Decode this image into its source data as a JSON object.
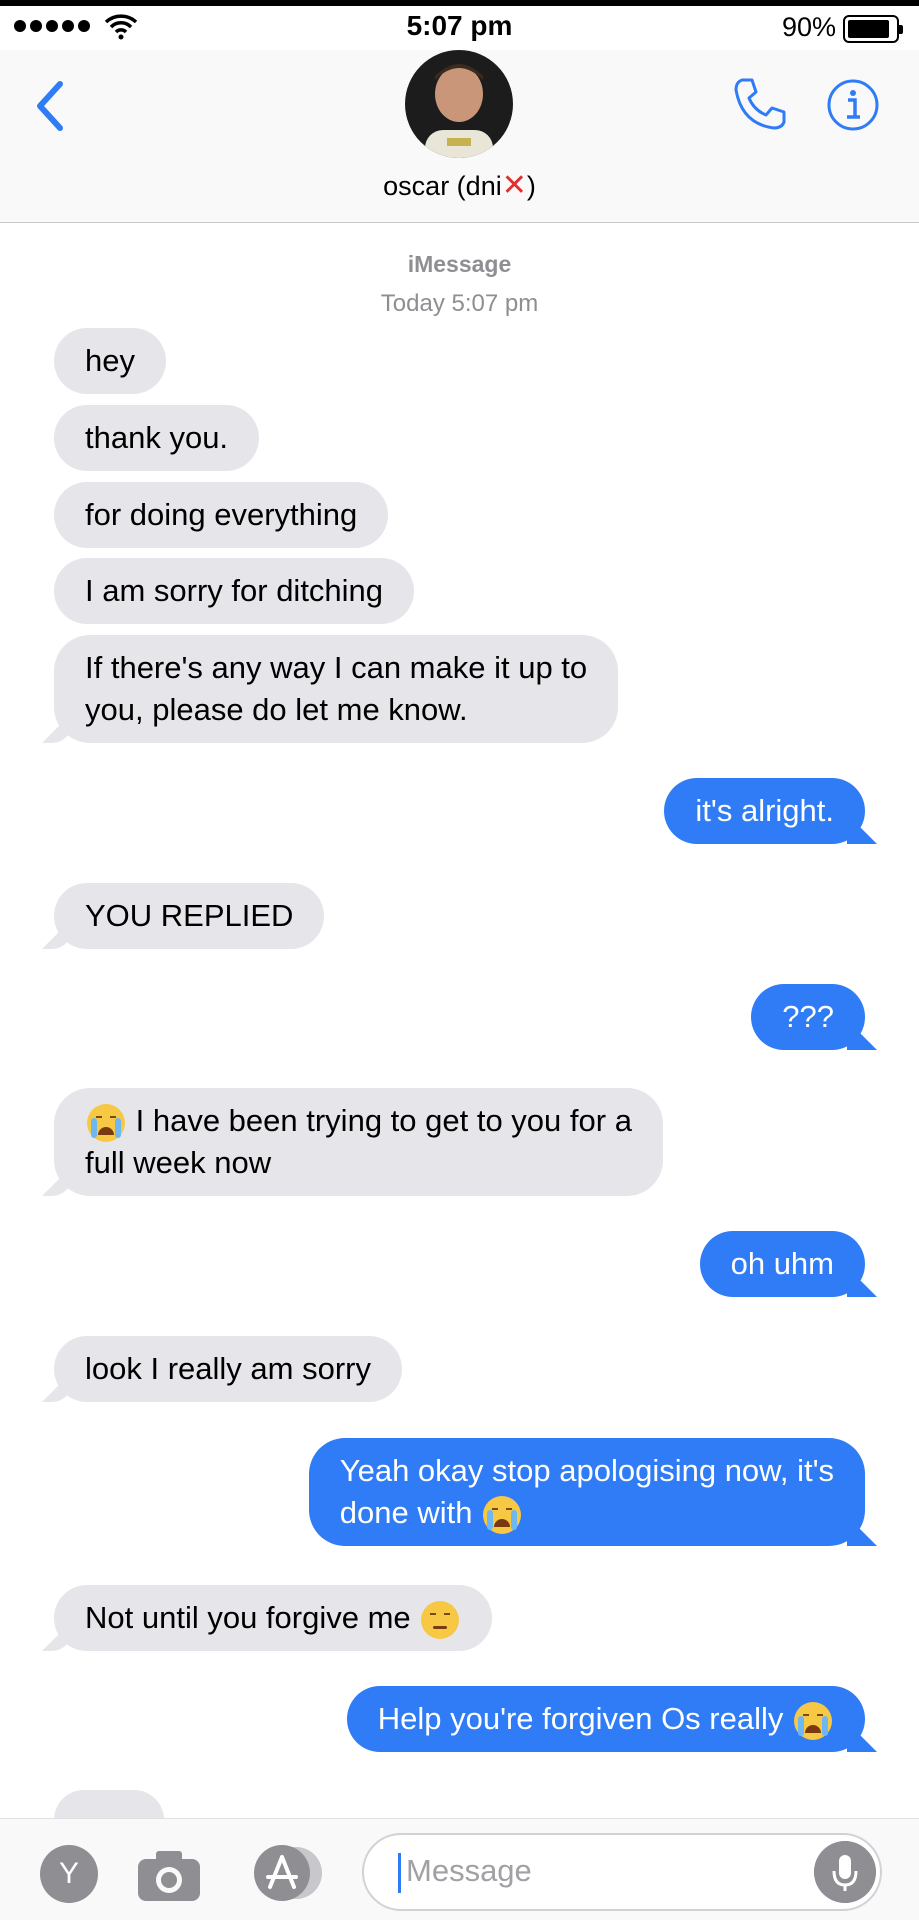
{
  "status": {
    "time": "5:07 pm",
    "battery": "90%"
  },
  "header": {
    "contact_name": "oscar (dni",
    "contact_suffix": ")"
  },
  "thread": {
    "service": "iMessage",
    "timestamp": "Today 5:07 pm"
  },
  "messages": [
    {
      "side": "in",
      "text": "hey"
    },
    {
      "side": "in",
      "text": "thank you."
    },
    {
      "side": "in",
      "text": "for doing everything"
    },
    {
      "side": "in",
      "text": "I am sorry for ditching"
    },
    {
      "side": "in",
      "line1": "If there's any way I can make it up to",
      "line2": "you, please do let me know."
    },
    {
      "side": "out",
      "text": "it's alright."
    },
    {
      "side": "in",
      "text": "YOU REPLIED"
    },
    {
      "side": "out",
      "text": "???"
    },
    {
      "side": "in",
      "emoji": "loudly-crying-face",
      "line1": " I have been trying to get to you for a",
      "line2": "full week now"
    },
    {
      "side": "out",
      "text": "oh uhm"
    },
    {
      "side": "in",
      "text": "look I really am sorry"
    },
    {
      "side": "out",
      "line1": "Yeah okay stop apologising now, it's",
      "line2": "done with",
      "emoji": "loudly-crying-face"
    },
    {
      "side": "in",
      "text": "Not until you forgive me",
      "emoji": "pensive-face"
    },
    {
      "side": "out",
      "text": "Help you're forgiven Os really",
      "emoji": "loudly-crying-face"
    }
  ],
  "input": {
    "placeholder": "Message",
    "app_letter": "Y"
  },
  "icons": {
    "back": "chevron-left-icon",
    "phone": "phone-icon",
    "info": "info-icon",
    "camera": "camera-icon",
    "appstore": "app-store-icon",
    "mic": "microphone-icon"
  },
  "colors": {
    "accent": "#2f7cf6",
    "incoming": "#e5e5ea",
    "red_x": "#e0302d"
  }
}
